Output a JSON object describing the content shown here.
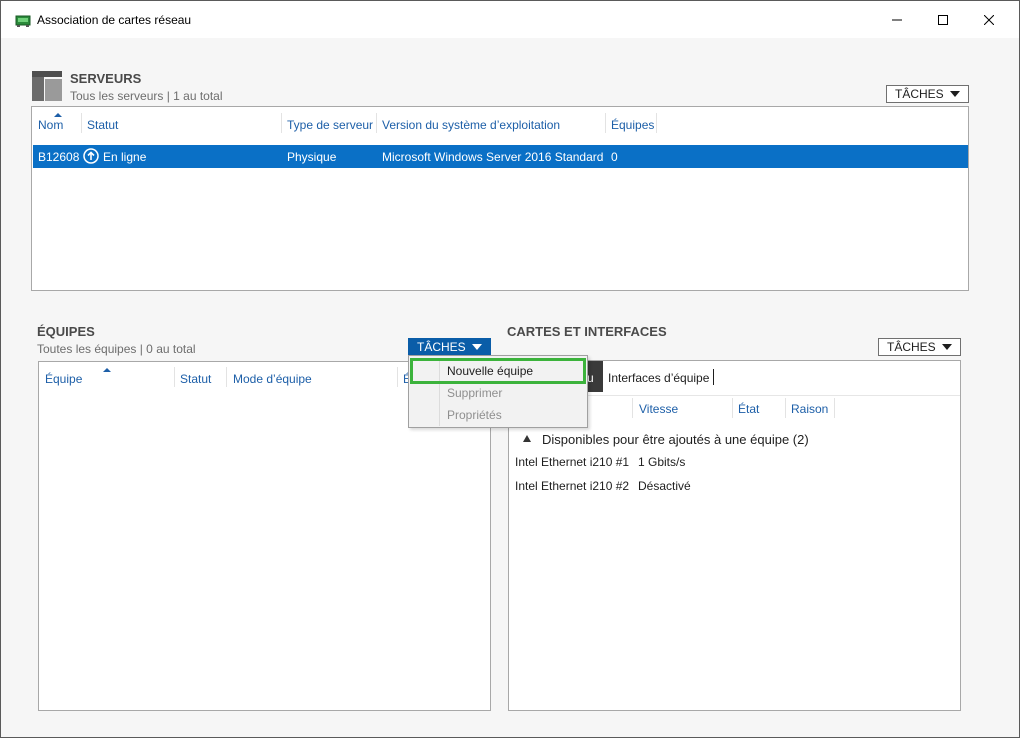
{
  "window": {
    "title": "Association de cartes réseau"
  },
  "servers": {
    "title": "SERVEURS",
    "subtitle": "Tous les serveurs | 1 au total",
    "tasks_label": "TÂCHES",
    "columns": [
      "Nom",
      "Statut",
      "Type de serveur",
      "Version du système d’exploitation",
      "Équipes"
    ],
    "rows": [
      {
        "name": "B12608",
        "status": "En ligne",
        "type": "Physique",
        "os": "Microsoft Windows Server 2016 Standard",
        "teams": "0"
      }
    ]
  },
  "teams": {
    "title": "ÉQUIPES",
    "subtitle": "Toutes les équipes | 0 au total",
    "tasks_label": "TÂCHES",
    "columns": [
      "Équipe",
      "Statut",
      "Mode d’équipe",
      "É"
    ],
    "menu": [
      {
        "label": "Nouvelle équipe",
        "enabled": true,
        "highlighted": true
      },
      {
        "label": "Supprimer",
        "enabled": false
      },
      {
        "label": "Propriétés",
        "enabled": false
      }
    ]
  },
  "cards": {
    "title": "CARTES ET INTERFACES",
    "tasks_label": "TÂCHES",
    "tabs": [
      {
        "label": "u",
        "active": true
      },
      {
        "label": "Interfaces d’équipe",
        "active": false
      }
    ],
    "columns": [
      "Vitesse",
      "État",
      "Raison"
    ],
    "group_label": "Disponibles pour être ajoutés à une équipe (2)",
    "adapters": [
      {
        "name": "Intel Ethernet i210 #1",
        "speed": "1 Gbits/s"
      },
      {
        "name": "Intel Ethernet i210 #2",
        "speed": "Désactivé"
      }
    ]
  },
  "colors": {
    "accent": "#0a70c6",
    "header_link": "#1d5fa8",
    "highlight_border": "#3cb33c"
  },
  "icons": {
    "app": "network-adapter-icon",
    "servers": "server-icon",
    "status_online": "arrow-up-circle-icon"
  }
}
